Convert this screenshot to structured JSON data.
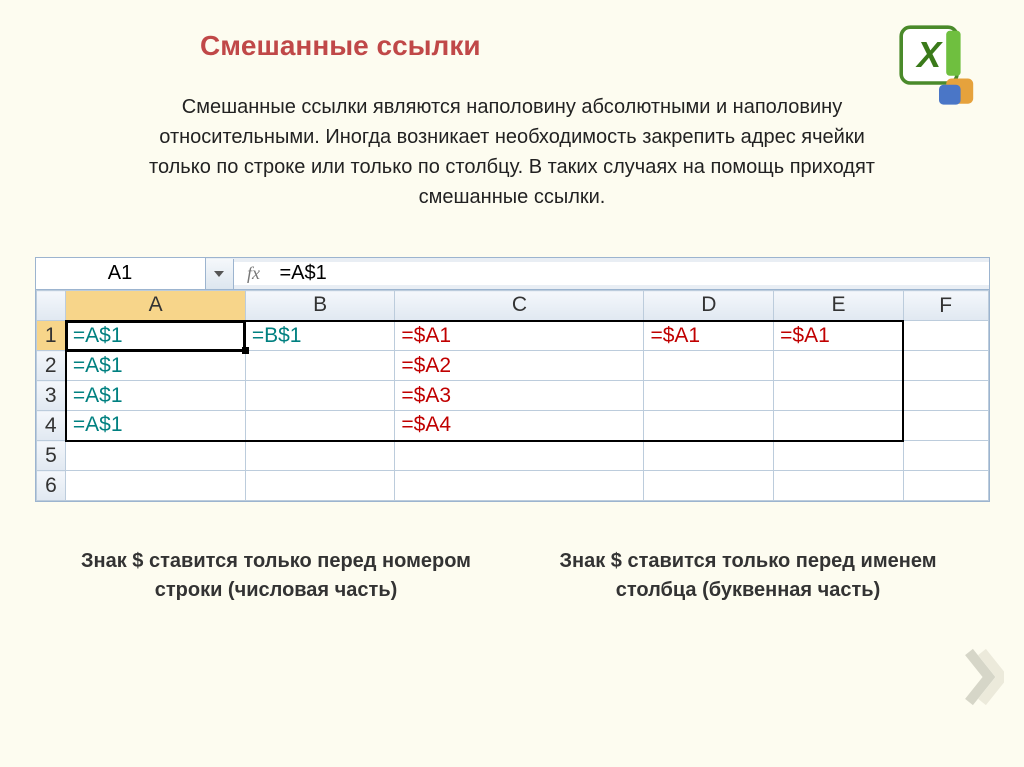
{
  "title": "Смешанные ссылки",
  "description": "Смешанные ссылки являются наполовину абсолютными и наполовину относительными. Иногда возникает необходимость закрепить адрес ячейки только по строке или только по столбцу. В таких случаях на помощь приходят смешанные ссылки.",
  "formula_bar": {
    "name_box": "A1",
    "fx_label": "fx",
    "value": "=A$1"
  },
  "columns": [
    "A",
    "B",
    "C",
    "D",
    "E",
    "F"
  ],
  "rows": [
    "1",
    "2",
    "3",
    "4",
    "5",
    "6"
  ],
  "cells": {
    "r1": {
      "A": "=A$1",
      "B": "=B$1",
      "C": "=$A1",
      "D": "=$A1",
      "E": "=$A1"
    },
    "r2": {
      "A": "=A$1",
      "C": "=$A2"
    },
    "r3": {
      "A": "=A$1",
      "C": "=$A3"
    },
    "r4": {
      "A": "=A$1",
      "C": "=$A4"
    }
  },
  "caption_left": "Знак $ ставится только перед номером строки (числовая часть)",
  "caption_right": "Знак $ ставится только перед именем столбца (буквенная часть)"
}
